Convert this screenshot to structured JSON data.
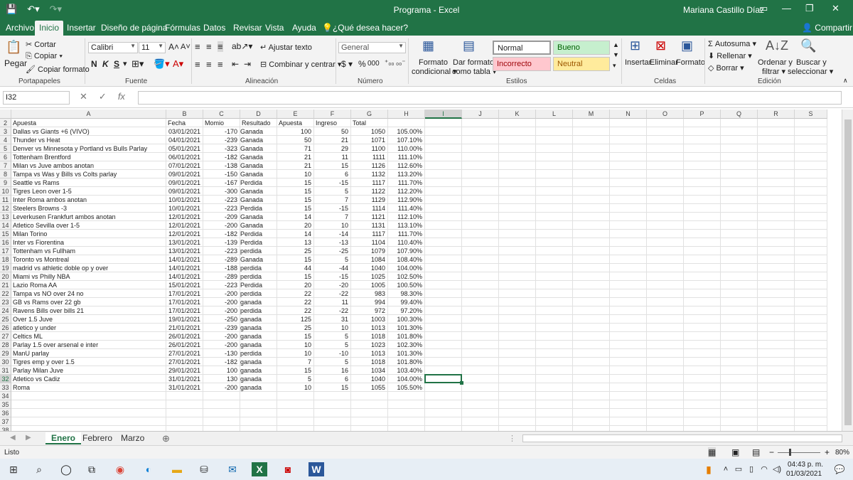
{
  "window": {
    "title": "Programa  -  Excel",
    "user": "Mariana  Castillo Díaz"
  },
  "tabs": [
    "Archivo",
    "Inicio",
    "Insertar",
    "Diseño de página",
    "Fórmulas",
    "Datos",
    "Revisar",
    "Vista",
    "Ayuda"
  ],
  "tell_me": "¿Qué desea hacer?",
  "share": "Compartir",
  "ribbon": {
    "paste": "Pegar",
    "cut": "Cortar",
    "copy": "Copiar",
    "format_painter": "Copiar formato",
    "font_name": "Calibri",
    "font_size": "11",
    "bold": "N",
    "italic": "K",
    "underline": "S",
    "wrap": "Ajustar texto",
    "merge": "Combinar y centrar",
    "number_format": "General",
    "currency": "$",
    "percent": "%",
    "thousands": "000",
    "cond_format_1": "Formato",
    "cond_format_2": "condicional",
    "table_format_1": "Dar formato",
    "table_format_2": "como tabla",
    "styles": {
      "normal": "Normal",
      "bueno": "Bueno",
      "incorrecto": "Incorrecto",
      "neutral": "Neutral"
    },
    "insert": "Insertar",
    "delete": "Eliminar",
    "format": "Formato",
    "autosum": "Autosuma",
    "fill": "Rellenar",
    "clear": "Borrar",
    "sort_1": "Ordenar y",
    "sort_2": "filtrar",
    "find_1": "Buscar y",
    "find_2": "seleccionar",
    "groups": {
      "clipboard": "Portapapeles",
      "font": "Fuente",
      "alignment": "Alineación",
      "number": "Número",
      "styles": "Estilos",
      "cells": "Celdas",
      "editing": "Edición"
    }
  },
  "name_box": "I32",
  "fx": "fx",
  "columns": [
    "A",
    "B",
    "C",
    "D",
    "E",
    "F",
    "G",
    "H",
    "I",
    "J",
    "K",
    "L",
    "M",
    "N",
    "O",
    "P",
    "Q",
    "R",
    "S"
  ],
  "headers_row": {
    "row": "2",
    "cells": [
      "Apuesta",
      "Fecha",
      "Momio",
      "Resultado",
      "Apuesta",
      "Ingreso",
      "Total",
      ""
    ]
  },
  "rows": [
    [
      "3",
      "Dallas vs Giants +6 (VIVO)",
      "03/01/2021",
      "-170",
      "Ganada",
      "100",
      "50",
      "1050",
      "105.00%"
    ],
    [
      "4",
      "Thunder vs Heat",
      "04/01/2021",
      "-239",
      "Ganada",
      "50",
      "21",
      "1071",
      "107.10%"
    ],
    [
      "5",
      "Denver vs Minnesota y Portland vs Bulls Parlay",
      "05/01/2021",
      "-323",
      "Ganada",
      "71",
      "29",
      "1100",
      "110.00%"
    ],
    [
      "6",
      "Tottenham Brentford",
      "06/01/2021",
      "-182",
      "Ganada",
      "21",
      "11",
      "1111",
      "111.10%"
    ],
    [
      "7",
      "Milan vs Juve ambos anotan",
      "07/01/2021",
      "-138",
      "Ganada",
      "21",
      "15",
      "1126",
      "112.60%"
    ],
    [
      "8",
      "Tampa vs Was y Bills vs Colts parlay",
      "09/01/2021",
      "-150",
      "Ganada",
      "10",
      "6",
      "1132",
      "113.20%"
    ],
    [
      "9",
      "Seattle vs Rams",
      "09/01/2021",
      "-167",
      "Perdida",
      "15",
      "-15",
      "1117",
      "111.70%"
    ],
    [
      "10",
      "Tigres Leon over 1-5",
      "09/01/2021",
      "-300",
      "Ganada",
      "15",
      "5",
      "1122",
      "112.20%"
    ],
    [
      "11",
      "Inter Roma ambos anotan",
      "10/01/2021",
      "-223",
      "Ganada",
      "15",
      "7",
      "1129",
      "112.90%"
    ],
    [
      "12",
      "Steelers Browns -3",
      "10/01/2021",
      "-223",
      "Perdida",
      "15",
      "-15",
      "1114",
      "111.40%"
    ],
    [
      "13",
      "Leverkusen Frankfurt ambos anotan",
      "12/01/2021",
      "-209",
      "Ganada",
      "14",
      "7",
      "1121",
      "112.10%"
    ],
    [
      "14",
      "Atletico Sevilla over 1-5",
      "12/01/2021",
      "-200",
      "Ganada",
      "20",
      "10",
      "1131",
      "113.10%"
    ],
    [
      "15",
      "Milan Torino",
      "12/01/2021",
      "-182",
      "Perdida",
      "14",
      "-14",
      "1117",
      "111.70%"
    ],
    [
      "16",
      "Inter vs Fiorentina",
      "13/01/2021",
      "-139",
      "Perdida",
      "13",
      "-13",
      "1104",
      "110.40%"
    ],
    [
      "17",
      "Tottenham vs Fullham",
      "13/01/2021",
      "-223",
      "perdida",
      "25",
      "-25",
      "1079",
      "107.90%"
    ],
    [
      "18",
      "Toronto vs Montreal",
      "14/01/2021",
      "-289",
      "Ganada",
      "15",
      "5",
      "1084",
      "108.40%"
    ],
    [
      "19",
      "madrid vs athletic doble op y over",
      "14/01/2021",
      "-188",
      "perdida",
      "44",
      "-44",
      "1040",
      "104.00%"
    ],
    [
      "20",
      "Miami vs Philly NBA",
      "14/01/2021",
      "-289",
      "perdida",
      "15",
      "-15",
      "1025",
      "102.50%"
    ],
    [
      "21",
      "Lazio Roma AA",
      "15/01/2021",
      "-223",
      "Perdida",
      "20",
      "-20",
      "1005",
      "100.50%"
    ],
    [
      "22",
      "Tampa vs NO over 24 no",
      "17/01/2021",
      "-200",
      "perdida",
      "22",
      "-22",
      "983",
      "98.30%"
    ],
    [
      "23",
      "GB vs Rams over 22 gb",
      "17/01/2021",
      "-200",
      "ganada",
      "22",
      "11",
      "994",
      "99.40%"
    ],
    [
      "24",
      "Ravens Bills over bills 21",
      "17/01/2021",
      "-200",
      "perdida",
      "22",
      "-22",
      "972",
      "97.20%"
    ],
    [
      "25",
      "Over 1.5 Juve",
      "19/01/2021",
      "-250",
      "ganada",
      "125",
      "31",
      "1003",
      "100.30%"
    ],
    [
      "26",
      "atletico y under",
      "21/01/2021",
      "-239",
      "ganada",
      "25",
      "10",
      "1013",
      "101.30%"
    ],
    [
      "27",
      "Celtics ML",
      "26/01/2021",
      "-200",
      "ganada",
      "15",
      "5",
      "1018",
      "101.80%"
    ],
    [
      "28",
      "Parlay 1.5 over arsenal e inter",
      "26/01/2021",
      "-200",
      "ganada",
      "10",
      "5",
      "1023",
      "102.30%"
    ],
    [
      "29",
      "ManU parlay",
      "27/01/2021",
      "-130",
      "perdida",
      "10",
      "-10",
      "1013",
      "101.30%"
    ],
    [
      "30",
      "Tigres emp y over 1.5",
      "27/01/2021",
      "-182",
      "ganada",
      "7",
      "5",
      "1018",
      "101.80%"
    ],
    [
      "31",
      "Parlay Milan Juve",
      "29/01/2021",
      "100",
      "ganada",
      "15",
      "16",
      "1034",
      "103.40%"
    ],
    [
      "32",
      "Atletico vs Cadiz",
      "31/01/2021",
      "130",
      "ganada",
      "5",
      "6",
      "1040",
      "104.00%"
    ],
    [
      "33",
      "Roma",
      "31/01/2021",
      "-200",
      "ganada",
      "10",
      "15",
      "1055",
      "105.50%"
    ]
  ],
  "empty_rows": [
    "34",
    "35",
    "36",
    "37",
    "38"
  ],
  "sheets": [
    "Enero",
    "Febrero",
    "Marzo"
  ],
  "status": {
    "ready": "Listo",
    "zoom": "80%"
  },
  "taskbar": {
    "time": "04:43 p. m.",
    "date": "01/03/2021"
  }
}
